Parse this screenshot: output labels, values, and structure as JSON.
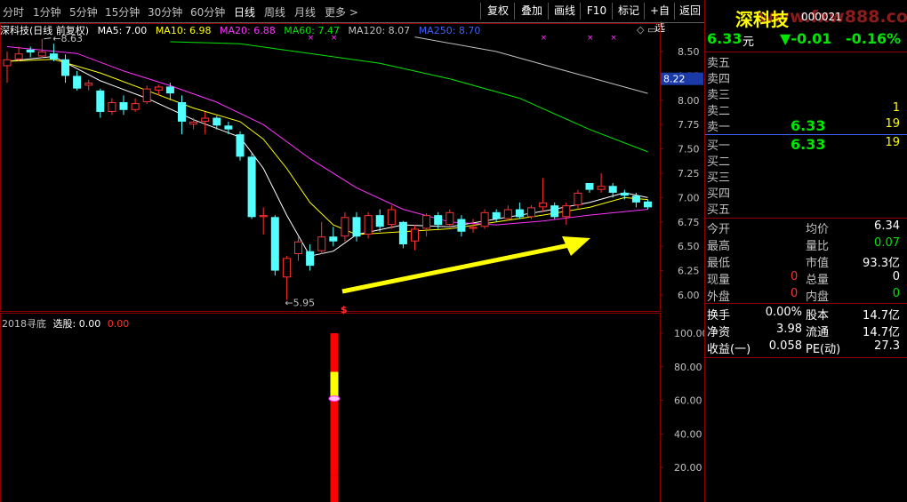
{
  "toolbar": {
    "periods": [
      "分时",
      "1分钟",
      "5分钟",
      "15分钟",
      "30分钟",
      "60分钟",
      "日线",
      "周线",
      "月线",
      "更多 >"
    ],
    "active_period": "日线",
    "buttons": [
      "复权",
      "叠加",
      "画线",
      "F10",
      "标记",
      "+自选",
      "返回"
    ]
  },
  "main_info": {
    "name": "深科技(日线 前复权)",
    "ma5": "MA5: 7.00",
    "ma10": "MA10: 6.98",
    "ma20": "MA20: 6.88",
    "ma60": "MA60: 7.47",
    "ma120": "MA120: 8.07",
    "ma250": "MA250: 8.70"
  },
  "indicator_info": {
    "name": "2018寻底",
    "label": "选股: 0.00",
    "value": "0.00"
  },
  "annotations": {
    "high_label": "8.63",
    "low_label": "5.95",
    "signal_mark": "$",
    "price_tag": "8.22"
  },
  "colors": {
    "up": "#ff3232",
    "down": "#54ffff",
    "ma5": "#ffffff",
    "ma10": "#ffff00",
    "ma20": "#ff32ff",
    "ma60": "#00e600",
    "ma120": "#c0c0c0",
    "arrow": "#ffff00",
    "frame": "#8b0000"
  },
  "chart_data": [
    {
      "type": "candlestick",
      "ylim": [
        5.9,
        8.7
      ],
      "yticks": [
        "8.50",
        "8.25",
        "8.00",
        "7.75",
        "7.50",
        "7.25",
        "7.00",
        "6.75",
        "6.50",
        "6.25",
        "6.00"
      ],
      "candles": [
        {
          "o": 8.35,
          "c": 8.42,
          "h": 8.5,
          "l": 8.18
        },
        {
          "o": 8.42,
          "c": 8.48,
          "h": 8.55,
          "l": 8.4
        },
        {
          "o": 8.52,
          "c": 8.49,
          "h": 8.55,
          "l": 8.44
        },
        {
          "o": 8.45,
          "c": 8.5,
          "h": 8.63,
          "l": 8.43
        },
        {
          "o": 8.48,
          "c": 8.42,
          "h": 8.58,
          "l": 8.4
        },
        {
          "o": 8.42,
          "c": 8.25,
          "h": 8.47,
          "l": 8.18
        },
        {
          "o": 8.25,
          "c": 8.12,
          "h": 8.3,
          "l": 8.1
        },
        {
          "o": 8.15,
          "c": 8.18,
          "h": 8.21,
          "l": 8.1
        },
        {
          "o": 8.1,
          "c": 7.88,
          "h": 8.12,
          "l": 7.82
        },
        {
          "o": 7.88,
          "c": 7.98,
          "h": 8.02,
          "l": 7.85
        },
        {
          "o": 7.98,
          "c": 7.9,
          "h": 8.05,
          "l": 7.85
        },
        {
          "o": 7.9,
          "c": 7.97,
          "h": 8.02,
          "l": 7.88
        },
        {
          "o": 7.98,
          "c": 8.12,
          "h": 8.15,
          "l": 7.96
        },
        {
          "o": 8.1,
          "c": 8.14,
          "h": 8.16,
          "l": 8.05
        },
        {
          "o": 8.14,
          "c": 8.07,
          "h": 8.18,
          "l": 8.0
        },
        {
          "o": 7.98,
          "c": 7.78,
          "h": 8.05,
          "l": 7.65
        },
        {
          "o": 7.75,
          "c": 7.78,
          "h": 7.82,
          "l": 7.7
        },
        {
          "o": 7.78,
          "c": 7.82,
          "h": 7.88,
          "l": 7.65
        },
        {
          "o": 7.82,
          "c": 7.74,
          "h": 7.84,
          "l": 7.7
        },
        {
          "o": 7.74,
          "c": 7.7,
          "h": 7.78,
          "l": 7.65
        },
        {
          "o": 7.65,
          "c": 7.42,
          "h": 7.68,
          "l": 7.38
        },
        {
          "o": 7.42,
          "c": 6.8,
          "h": 7.45,
          "l": 6.78
        },
        {
          "o": 6.8,
          "c": 6.82,
          "h": 6.9,
          "l": 6.62
        },
        {
          "o": 6.8,
          "c": 6.25,
          "h": 6.82,
          "l": 6.2
        },
        {
          "o": 6.18,
          "c": 6.38,
          "h": 6.4,
          "l": 5.95
        },
        {
          "o": 6.42,
          "c": 6.55,
          "h": 6.6,
          "l": 6.35
        },
        {
          "o": 6.45,
          "c": 6.3,
          "h": 6.52,
          "l": 6.25
        },
        {
          "o": 6.45,
          "c": 6.6,
          "h": 6.75,
          "l": 6.42
        },
        {
          "o": 6.6,
          "c": 6.55,
          "h": 6.7,
          "l": 6.5
        },
        {
          "o": 6.6,
          "c": 6.8,
          "h": 6.85,
          "l": 6.55
        },
        {
          "o": 6.8,
          "c": 6.6,
          "h": 6.85,
          "l": 6.55
        },
        {
          "o": 6.62,
          "c": 6.82,
          "h": 6.85,
          "l": 6.58
        },
        {
          "o": 6.82,
          "c": 6.7,
          "h": 6.88,
          "l": 6.65
        },
        {
          "o": 6.72,
          "c": 6.88,
          "h": 6.92,
          "l": 6.68
        },
        {
          "o": 6.75,
          "c": 6.52,
          "h": 6.76,
          "l": 6.48
        },
        {
          "o": 6.55,
          "c": 6.68,
          "h": 6.72,
          "l": 6.46
        },
        {
          "o": 6.68,
          "c": 6.82,
          "h": 6.84,
          "l": 6.6
        },
        {
          "o": 6.82,
          "c": 6.72,
          "h": 6.85,
          "l": 6.68
        },
        {
          "o": 6.72,
          "c": 6.85,
          "h": 6.88,
          "l": 6.68
        },
        {
          "o": 6.78,
          "c": 6.65,
          "h": 6.82,
          "l": 6.6
        },
        {
          "o": 6.68,
          "c": 6.7,
          "h": 6.78,
          "l": 6.64
        },
        {
          "o": 6.7,
          "c": 6.85,
          "h": 6.88,
          "l": 6.68
        },
        {
          "o": 6.85,
          "c": 6.78,
          "h": 6.88,
          "l": 6.75
        },
        {
          "o": 6.78,
          "c": 6.88,
          "h": 6.92,
          "l": 6.76
        },
        {
          "o": 6.88,
          "c": 6.8,
          "h": 6.95,
          "l": 6.78
        },
        {
          "o": 6.8,
          "c": 6.9,
          "h": 6.92,
          "l": 6.78
        },
        {
          "o": 6.9,
          "c": 6.95,
          "h": 7.2,
          "l": 6.85
        },
        {
          "o": 6.92,
          "c": 6.8,
          "h": 6.95,
          "l": 6.78
        },
        {
          "o": 6.8,
          "c": 6.92,
          "h": 6.95,
          "l": 6.72
        },
        {
          "o": 6.92,
          "c": 7.05,
          "h": 7.08,
          "l": 6.88
        },
        {
          "o": 7.15,
          "c": 7.08,
          "h": 7.15,
          "l": 7.05
        },
        {
          "o": 7.08,
          "c": 7.12,
          "h": 7.25,
          "l": 7.05
        },
        {
          "o": 7.12,
          "c": 7.05,
          "h": 7.15,
          "l": 7.0
        },
        {
          "o": 7.05,
          "c": 7.02,
          "h": 7.08,
          "l": 6.98
        },
        {
          "o": 7.02,
          "c": 6.95,
          "h": 7.05,
          "l": 6.9
        },
        {
          "o": 6.96,
          "c": 6.9,
          "h": 6.98,
          "l": 6.88
        }
      ],
      "ma_series": [
        {
          "name": "MA5",
          "color": "#ffffff",
          "points": [
            [
              0,
              8.4
            ],
            [
              4,
              8.45
            ],
            [
              8,
              8.2
            ],
            [
              12,
              8.02
            ],
            [
              16,
              7.8
            ],
            [
              20,
              7.62
            ],
            [
              22,
              7.3
            ],
            [
              24,
              6.82
            ],
            [
              26,
              6.4
            ],
            [
              28,
              6.45
            ],
            [
              30,
              6.62
            ],
            [
              34,
              6.72
            ],
            [
              38,
              6.7
            ],
            [
              42,
              6.78
            ],
            [
              46,
              6.86
            ],
            [
              50,
              6.95
            ],
            [
              53,
              7.05
            ],
            [
              55,
              7.0
            ]
          ]
        },
        {
          "name": "MA10",
          "color": "#ffff00",
          "points": [
            [
              0,
              8.4
            ],
            [
              4,
              8.42
            ],
            [
              8,
              8.28
            ],
            [
              12,
              8.1
            ],
            [
              16,
              7.92
            ],
            [
              20,
              7.78
            ],
            [
              22,
              7.6
            ],
            [
              24,
              7.3
            ],
            [
              26,
              6.95
            ],
            [
              28,
              6.72
            ],
            [
              30,
              6.62
            ],
            [
              34,
              6.65
            ],
            [
              38,
              6.68
            ],
            [
              42,
              6.75
            ],
            [
              46,
              6.82
            ],
            [
              50,
              6.9
            ],
            [
              53,
              7.0
            ],
            [
              55,
              6.98
            ]
          ]
        },
        {
          "name": "MA20",
          "color": "#ff32ff",
          "points": [
            [
              0,
              8.55
            ],
            [
              6,
              8.48
            ],
            [
              10,
              8.3
            ],
            [
              14,
              8.15
            ],
            [
              18,
              7.98
            ],
            [
              22,
              7.75
            ],
            [
              26,
              7.4
            ],
            [
              30,
              7.1
            ],
            [
              34,
              6.88
            ],
            [
              38,
              6.75
            ],
            [
              42,
              6.72
            ],
            [
              46,
              6.76
            ],
            [
              50,
              6.82
            ],
            [
              55,
              6.88
            ]
          ]
        },
        {
          "name": "MA60",
          "color": "#00e600",
          "points": [
            [
              14,
              8.6
            ],
            [
              20,
              8.58
            ],
            [
              26,
              8.48
            ],
            [
              32,
              8.38
            ],
            [
              38,
              8.22
            ],
            [
              44,
              8.02
            ],
            [
              50,
              7.7
            ],
            [
              55,
              7.47
            ]
          ]
        },
        {
          "name": "MA120",
          "color": "#c0c0c0",
          "points": [
            [
              35,
              8.65
            ],
            [
              42,
              8.5
            ],
            [
              48,
              8.3
            ],
            [
              55,
              8.07
            ]
          ]
        }
      ]
    },
    {
      "type": "bar",
      "title": "2018寻底",
      "ylim": [
        0,
        105
      ],
      "yticks": [
        "100.00",
        "80.00",
        "60.00",
        "40.00",
        "20.00"
      ],
      "signal_index": 24,
      "segments": [
        {
          "from": 0,
          "to": 15,
          "color": "#ff0000"
        },
        {
          "from": 15,
          "to": 60,
          "color": "#ff0000"
        },
        {
          "from": 60,
          "to": 77,
          "color": "#ffff00"
        },
        {
          "from": 77,
          "to": 100,
          "color": "#ff0000"
        }
      ]
    }
  ],
  "quote": {
    "name": "深科技",
    "code": "000021",
    "watermark": "www.fxw888.com",
    "price": "6.33",
    "unit": "元",
    "change": "▼-0.01",
    "pct": "-0.16%",
    "sell": [
      {
        "label": "卖五",
        "price": "",
        "vol": ""
      },
      {
        "label": "卖四",
        "price": "",
        "vol": ""
      },
      {
        "label": "卖三",
        "price": "",
        "vol": ""
      },
      {
        "label": "卖二",
        "price": "",
        "vol": "1"
      },
      {
        "label": "卖一",
        "price": "6.33",
        "vol": "19"
      }
    ],
    "buy": [
      {
        "label": "买一",
        "price": "6.33",
        "vol": "19"
      },
      {
        "label": "买二",
        "price": "",
        "vol": ""
      },
      {
        "label": "买三",
        "price": "",
        "vol": ""
      },
      {
        "label": "买四",
        "price": "",
        "vol": ""
      },
      {
        "label": "买五",
        "price": "",
        "vol": ""
      }
    ],
    "stats": [
      {
        "l1": "今开",
        "v1": "",
        "l2": "均价",
        "v2": "6.34",
        "c2": "#ffffff"
      },
      {
        "l1": "最高",
        "v1": "",
        "l2": "量比",
        "v2": "0.07",
        "c2": "#00e600"
      },
      {
        "l1": "最低",
        "v1": "",
        "l2": "市值",
        "v2": "93.3亿",
        "c2": "#ffffff"
      },
      {
        "l1": "现量",
        "v1": "0",
        "c1": "#ff3232",
        "l2": "总量",
        "v2": "0",
        "c2": "#ffffff"
      },
      {
        "l1": "外盘",
        "v1": "0",
        "c1": "#ff3232",
        "l2": "内盘",
        "v2": "0",
        "c2": "#00e600"
      }
    ],
    "stats2": [
      {
        "l1": "换手",
        "v1": "0.00%",
        "l2": "股本",
        "v2": "14.7亿"
      },
      {
        "l1": "净资",
        "v1": "3.98",
        "l2": "流通",
        "v2": "14.7亿"
      },
      {
        "l1": "收益(一)",
        "v1": "0.058",
        "l2": "PE(动)",
        "v2": "27.3"
      }
    ]
  }
}
